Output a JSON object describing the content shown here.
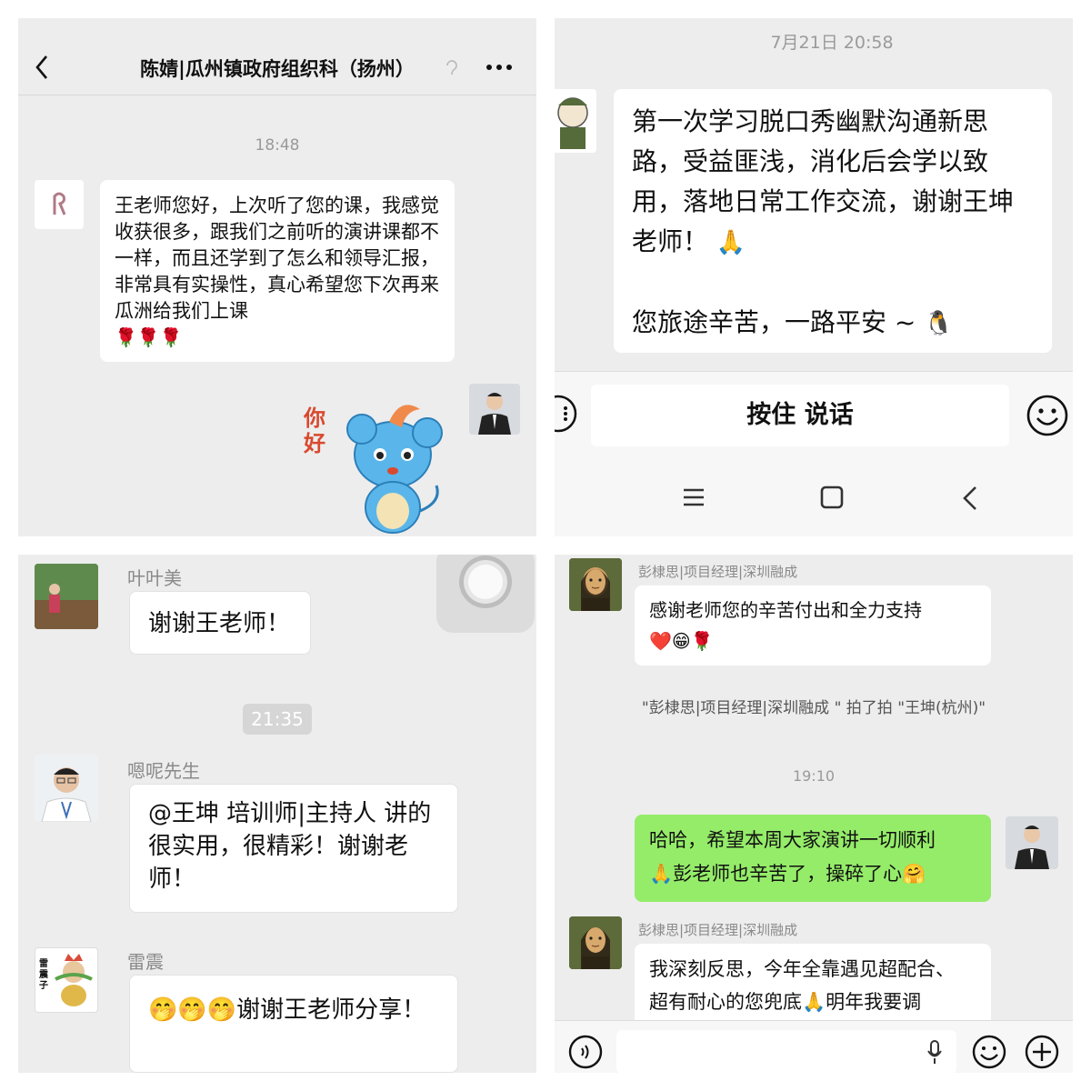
{
  "p1": {
    "title": "陈婧|瓜州镇政府组织科（扬州）",
    "time": "18:48",
    "message": "王老师您好，上次听了您的课，我感觉收获很多，跟我们之前听的演讲课都不一样，而且还学到了怎么和领导汇报，非常具有实操性，真心希望您下次再来瓜洲给我们上课",
    "roses": "🌹🌹🌹",
    "sticker_text": "你好"
  },
  "p2": {
    "time": "7月21日 20:58",
    "message_line1": "第一次学习脱口秀幽默沟通新思路，受益匪浅，消化后会学以致用，落地日常工作交流，谢谢王坤老师！",
    "message_line1_emoji": "🙏",
    "message_line2": "您旅途辛苦，一路平安 ~",
    "message_line2_emoji": "🐧",
    "hold_to_talk": "按住 说话"
  },
  "p3": {
    "messages": [
      {
        "name": "叶叶美",
        "text": "谢谢王老师！"
      },
      {
        "name": "嗯呢先生",
        "text": "@王坤  培训师|主持人 讲的很实用，很精彩！谢谢老师！"
      },
      {
        "name": "雷震",
        "text": "🤭🤭🤭谢谢王老师分享！"
      }
    ],
    "time": "21:35",
    "avatar_label": "雷震子"
  },
  "p4": {
    "sender_name": "彭棣思|项目经理|深圳融成",
    "msg1": "感谢老师您的辛苦付出和全力支持",
    "msg1_emoji": "❤️😁🌹",
    "system": "\"彭棣思|项目经理|深圳融成 \" 拍了拍 \"王坤(杭州)\"",
    "time": "19:10",
    "my_msg_line1": "哈哈，希望本周大家演讲一切顺利",
    "my_msg_line2_pre": "🙏",
    "my_msg_line2": "彭老师也辛苦了，操碎了心",
    "my_msg_line2_emoji": "🤗",
    "msg3_line1": "我深刻反思，今年全靠遇见超配合、",
    "msg3_line2_pre": "超有耐心的您兜底",
    "msg3_emoji": "🙏",
    "msg3_line2_post": "明年我要调"
  },
  "colors": {
    "chat_bg": "#ededed",
    "bubble_self": "#95ec69",
    "bubble_other": "#ffffff",
    "secondary_text": "#8a8a8a"
  }
}
